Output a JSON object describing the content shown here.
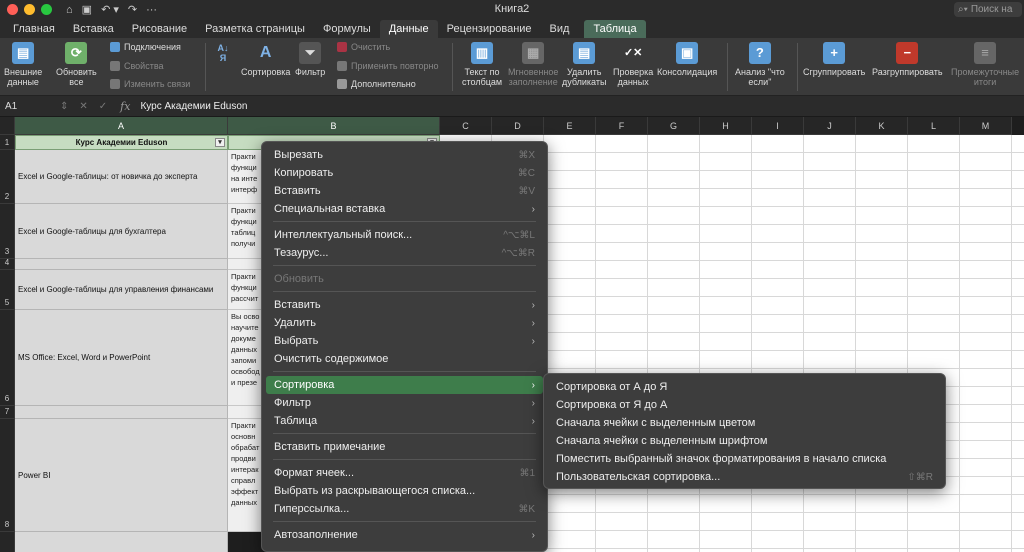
{
  "window": {
    "title": "Книга2",
    "search_placeholder": "Поиск на"
  },
  "colors": {
    "close": "#ff5f57",
    "minimize": "#febc2e",
    "zoom": "#28c840",
    "accent": "#3e7d4b"
  },
  "tabs": [
    "Главная",
    "Вставка",
    "Рисование",
    "Разметка страницы",
    "Формулы",
    "Данные",
    "Рецензирование",
    "Вид",
    "Таблица"
  ],
  "active_tab": "Данные",
  "ribbon": {
    "external": "Внешние\nданные",
    "refresh": "Обновить\nвсе",
    "connections": "Подключения",
    "properties": "Свойства",
    "edit_links": "Изменить связи",
    "sort": "Сортировка",
    "filter": "Фильтр",
    "clear": "Очистить",
    "reapply": "Применить повторно",
    "advanced": "Дополнительно",
    "text_to_columns": "Текст по\nстолбцам",
    "flash_fill": "Мгновенное\nзаполнение",
    "remove_duplicates": "Удалить\nдубликаты",
    "data_validation": "Проверка\nданных",
    "consolidate": "Консолидация",
    "what_if": "Анализ \"что\nесли\"",
    "group": "Сгруппировать",
    "ungroup": "Разгруппировать",
    "subtotal": "Промежуточные\nитоги"
  },
  "formula_bar": {
    "cell": "A1",
    "content": "Курс Академии Eduson",
    "fx": "fx"
  },
  "columns": [
    "A",
    "B",
    "C",
    "D",
    "E",
    "F",
    "G",
    "H",
    "I",
    "J",
    "K",
    "L",
    "M"
  ],
  "rows": [
    "1",
    "2",
    "3",
    "4",
    "5",
    "6",
    "7",
    "8"
  ],
  "sheet": {
    "header": "Курс Академии Eduson",
    "cells": [
      {
        "row": "2",
        "a": "Excel и Google-таблицы: от новичка до эксперта",
        "b": "Практи\nфункци\nна инте\nинтерф"
      },
      {
        "row": "3",
        "a": "Excel и Google-таблицы для бухгалтера",
        "b": "Практи\nфункци\nтаблиц\nполучи"
      },
      {
        "row": "4",
        "a": "",
        "b": ""
      },
      {
        "row": "5",
        "a": "Excel и Google-таблицы для управления финансами",
        "b": "Практи\nфункци\nрассчит"
      },
      {
        "row": "6",
        "a": "MS Office: Excel, Word и PowerPoint",
        "b": "Вы осво\nнаучите\nдокуме\nданных\nзапоми\nосвобод\nи презе"
      },
      {
        "row": "7",
        "a": "",
        "b": ""
      },
      {
        "row": "8",
        "a": "Power BI",
        "b": "Практи\nосновн\nобрабат\nпродви\nинтерак\nсправл\nэффект\nданных"
      }
    ]
  },
  "context_menu": [
    {
      "label": "Вырезать",
      "shortcut": "⌘X"
    },
    {
      "label": "Копировать",
      "shortcut": "⌘C"
    },
    {
      "label": "Вставить",
      "shortcut": "⌘V"
    },
    {
      "label": "Специальная вставка",
      "arrow": true
    },
    {
      "sep": true
    },
    {
      "label": "Интеллектуальный поиск...",
      "shortcut": "^⌥⌘L"
    },
    {
      "label": "Тезаурус...",
      "shortcut": "^⌥⌘R"
    },
    {
      "sep": true
    },
    {
      "label": "Обновить",
      "disabled": true
    },
    {
      "sep": true
    },
    {
      "label": "Вставить",
      "arrow": true
    },
    {
      "label": "Удалить",
      "arrow": true
    },
    {
      "label": "Выбрать",
      "arrow": true
    },
    {
      "label": "Очистить содержимое"
    },
    {
      "sep": true
    },
    {
      "label": "Сортировка",
      "arrow": true,
      "highlight": true
    },
    {
      "label": "Фильтр",
      "arrow": true
    },
    {
      "label": "Таблица",
      "arrow": true
    },
    {
      "sep": true
    },
    {
      "label": "Вставить примечание"
    },
    {
      "sep": true
    },
    {
      "label": "Формат ячеек...",
      "shortcut": "⌘1"
    },
    {
      "label": "Выбрать из раскрывающегося списка..."
    },
    {
      "label": "Гиперссылка...",
      "shortcut": "⌘K"
    },
    {
      "sep": true
    },
    {
      "label": "Автозаполнение",
      "arrow": true
    }
  ],
  "sort_submenu": [
    {
      "label": "Сортировка от А до Я"
    },
    {
      "label": "Сортировка от Я до А"
    },
    {
      "label": "Сначала ячейки с выделенным цветом"
    },
    {
      "label": "Сначала ячейки с выделенным шрифтом"
    },
    {
      "label": "Поместить выбранный значок форматирования в начало списка"
    },
    {
      "label": "Пользовательская сортировка...",
      "shortcut": "⇧⌘R"
    }
  ]
}
